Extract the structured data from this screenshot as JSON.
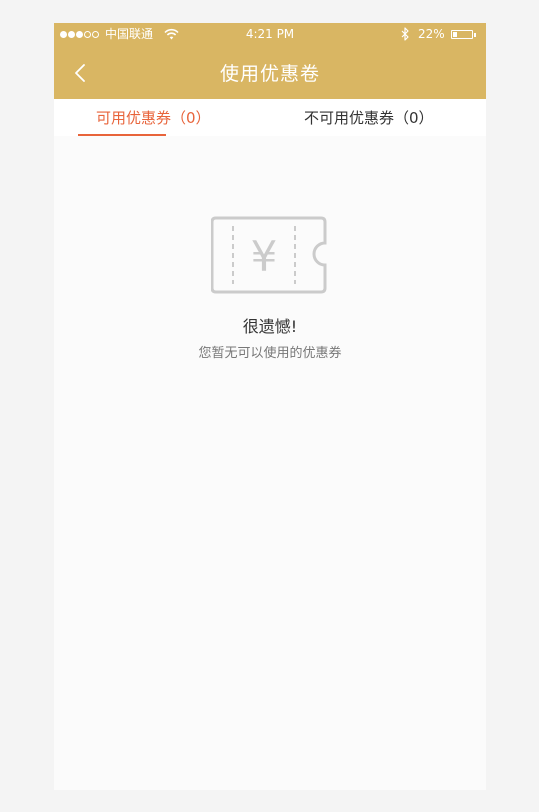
{
  "status_bar": {
    "signal_dots_full": 3,
    "signal_dots_total": 5,
    "carrier": "中国联通",
    "time": "4:21 PM",
    "battery_percent": "22%",
    "battery_level": 0.22
  },
  "nav": {
    "title": "使用优惠卷"
  },
  "tabs": [
    {
      "label": "可用优惠券（0）",
      "active": true
    },
    {
      "label": "不可用优惠券（0）",
      "active": false
    }
  ],
  "empty_state": {
    "icon": "coupon-ticket-yen-icon",
    "icon_text": "¥",
    "title": "很遗憾!",
    "description": "您暂无可以使用的优惠券"
  },
  "colors": {
    "header": "#d9b663",
    "accent": "#e8643b",
    "background": "#fbfbfb",
    "page_background": "#f4f4f4",
    "icon_gray": "#cbcbcb"
  }
}
